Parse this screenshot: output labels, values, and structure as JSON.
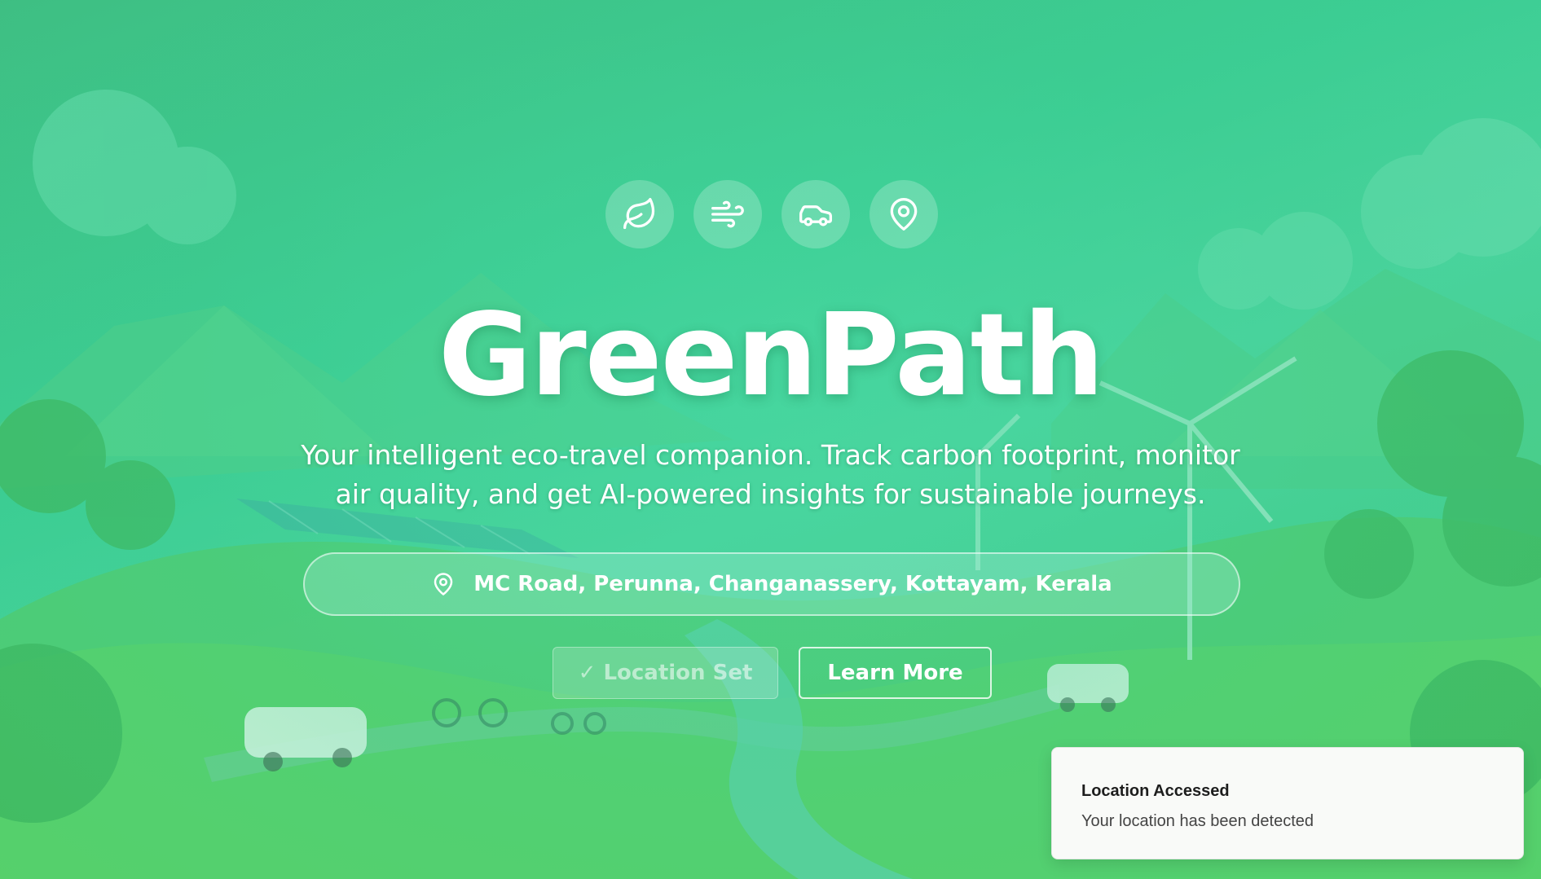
{
  "hero": {
    "icons": [
      "leaf-icon",
      "wind-icon",
      "car-icon",
      "map-pin-icon"
    ],
    "title": "GreenPath",
    "subtitle": "Your intelligent eco-travel companion. Track carbon footprint, monitor air quality, and get AI-powered insights for sustainable journeys."
  },
  "location": {
    "icon": "map-pin-icon",
    "address": "MC Road, Perunna, Changanassery, Kottayam, Kerala"
  },
  "actions": {
    "location_set_label": "✓ Location Set",
    "learn_more_label": "Learn More"
  },
  "toast": {
    "title": "Location Accessed",
    "description": "Your location has been detected"
  },
  "colors": {
    "background": "#3ccf95",
    "toast_bg": "#f9faf8"
  }
}
